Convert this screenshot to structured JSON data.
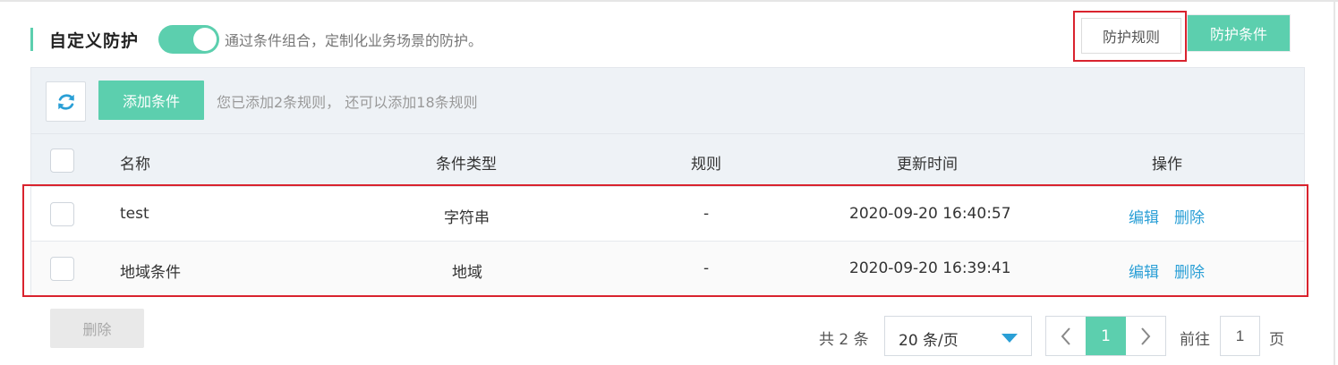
{
  "colors": {
    "accent": "#5ccfae",
    "link": "#2a9fd6",
    "highlight": "#d9232e",
    "dropdown_caret": "#2a9fd6"
  },
  "header": {
    "title": "自定义防护",
    "toggle_on": true,
    "description": "通过条件组合，定制化业务场景的防护。",
    "tab_rules": "防护规则",
    "tab_conditions": "防护条件"
  },
  "toolbar": {
    "refresh_icon": "refresh-icon",
    "add_button": "添加条件",
    "info": "您已添加2条规则， 还可以添加18条规则"
  },
  "table": {
    "columns": [
      "名称",
      "条件类型",
      "规则",
      "更新时间",
      "操作"
    ],
    "rows": [
      {
        "name": "test",
        "type": "字符串",
        "rule": "-",
        "updated": "2020-09-20 16:40:57",
        "edit": "编辑",
        "delete": "删除"
      },
      {
        "name": "地域条件",
        "type": "地域",
        "rule": "-",
        "updated": "2020-09-20 16:39:41",
        "edit": "编辑",
        "delete": "删除"
      }
    ]
  },
  "footer": {
    "delete_button": "删除",
    "total": "共 2 条",
    "page_size": "20 条/页",
    "current_page": "1",
    "goto_label": "前往",
    "goto_value": "1",
    "page_suffix": "页"
  }
}
